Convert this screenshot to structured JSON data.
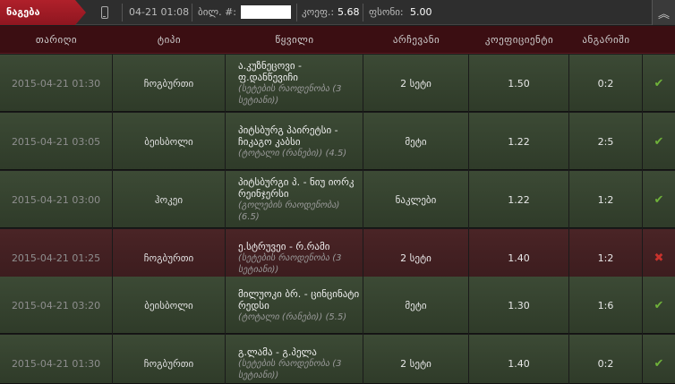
{
  "topbar": {
    "active_tab": "ნაგება",
    "time": "04-21 01:08",
    "ticket_label": "ბილ. #:",
    "ticket_value": "",
    "coef_label": "კოეფ.:",
    "coef_value": "5.68",
    "stake_label": "ფსონი:",
    "stake_value": "5.00"
  },
  "table": {
    "headers": [
      "თარიღი",
      "ტიპი",
      "წყვილი",
      "არჩევანი",
      "კოეფიციენტი",
      "ანგარიში"
    ],
    "rows": [
      {
        "date": "2015-04-21 01:30",
        "sport": "ჩოგბურთი",
        "event": "ა.კუზნეცოვი - ფ.დანწევიჩი",
        "sub": "(სეტების რაოდენობა (3 სეტიანი))",
        "choice": "2 სეტი",
        "coef": "1.50",
        "result": "0:2",
        "status": "won"
      },
      {
        "date": "2015-04-21 03:05",
        "sport": "ბეისბოლი",
        "event": "პიტსბურგ პაირეტსი - ჩიკაგო კაბსი",
        "sub": "(ტოტალი (რანები)) (4.5)",
        "choice": "მეტი",
        "coef": "1.22",
        "result": "2:5",
        "status": "won"
      },
      {
        "date": "2015-04-21 03:00",
        "sport": "ჰოკეი",
        "event": "პიტსბურგი პ. - ნიუ იორკ რეინჯერსი",
        "sub": "(გოლების რაოდენობა) (6.5)",
        "choice": "ნაკლები",
        "coef": "1.22",
        "result": "1:2",
        "status": "won"
      },
      {
        "date": "2015-04-21 01:25",
        "sport": "ჩოგბურთი",
        "event": "ე.სტრუვეი - რ.რამი",
        "sub": "(სეტების რაოდენობა (3 სეტიანი))",
        "choice": "2 სეტი",
        "coef": "1.40",
        "result": "1:2",
        "status": "lost"
      },
      {
        "date": "2015-04-21 03:20",
        "sport": "ბეისბოლი",
        "event": "მილუოკი ბრ. - ცინცინატი რედსი",
        "sub": "(ტოტალი (რანები)) (5.5)",
        "choice": "მეტი",
        "coef": "1.30",
        "result": "1:6",
        "status": "won"
      },
      {
        "date": "2015-04-21 01:30",
        "sport": "ჩოგბურთი",
        "event": "გ.ლამა - გ.პელა",
        "sub": "(სეტების რაოდენობა (3 სეტიანი))",
        "choice": "2 სეტი",
        "coef": "1.40",
        "result": "0:2",
        "status": "won"
      }
    ]
  },
  "icons": {
    "phone": "phone-icon",
    "collapse": "chevron-up-double-icon",
    "won": "check-icon",
    "lost": "cross-icon"
  },
  "colors": {
    "active_tab": "#b0202a",
    "header_bg": "#3b0e12",
    "won_row": "#3c4a35",
    "lost_row": "#4a2426",
    "check": "#6fb23a",
    "cross": "#c8322c"
  }
}
